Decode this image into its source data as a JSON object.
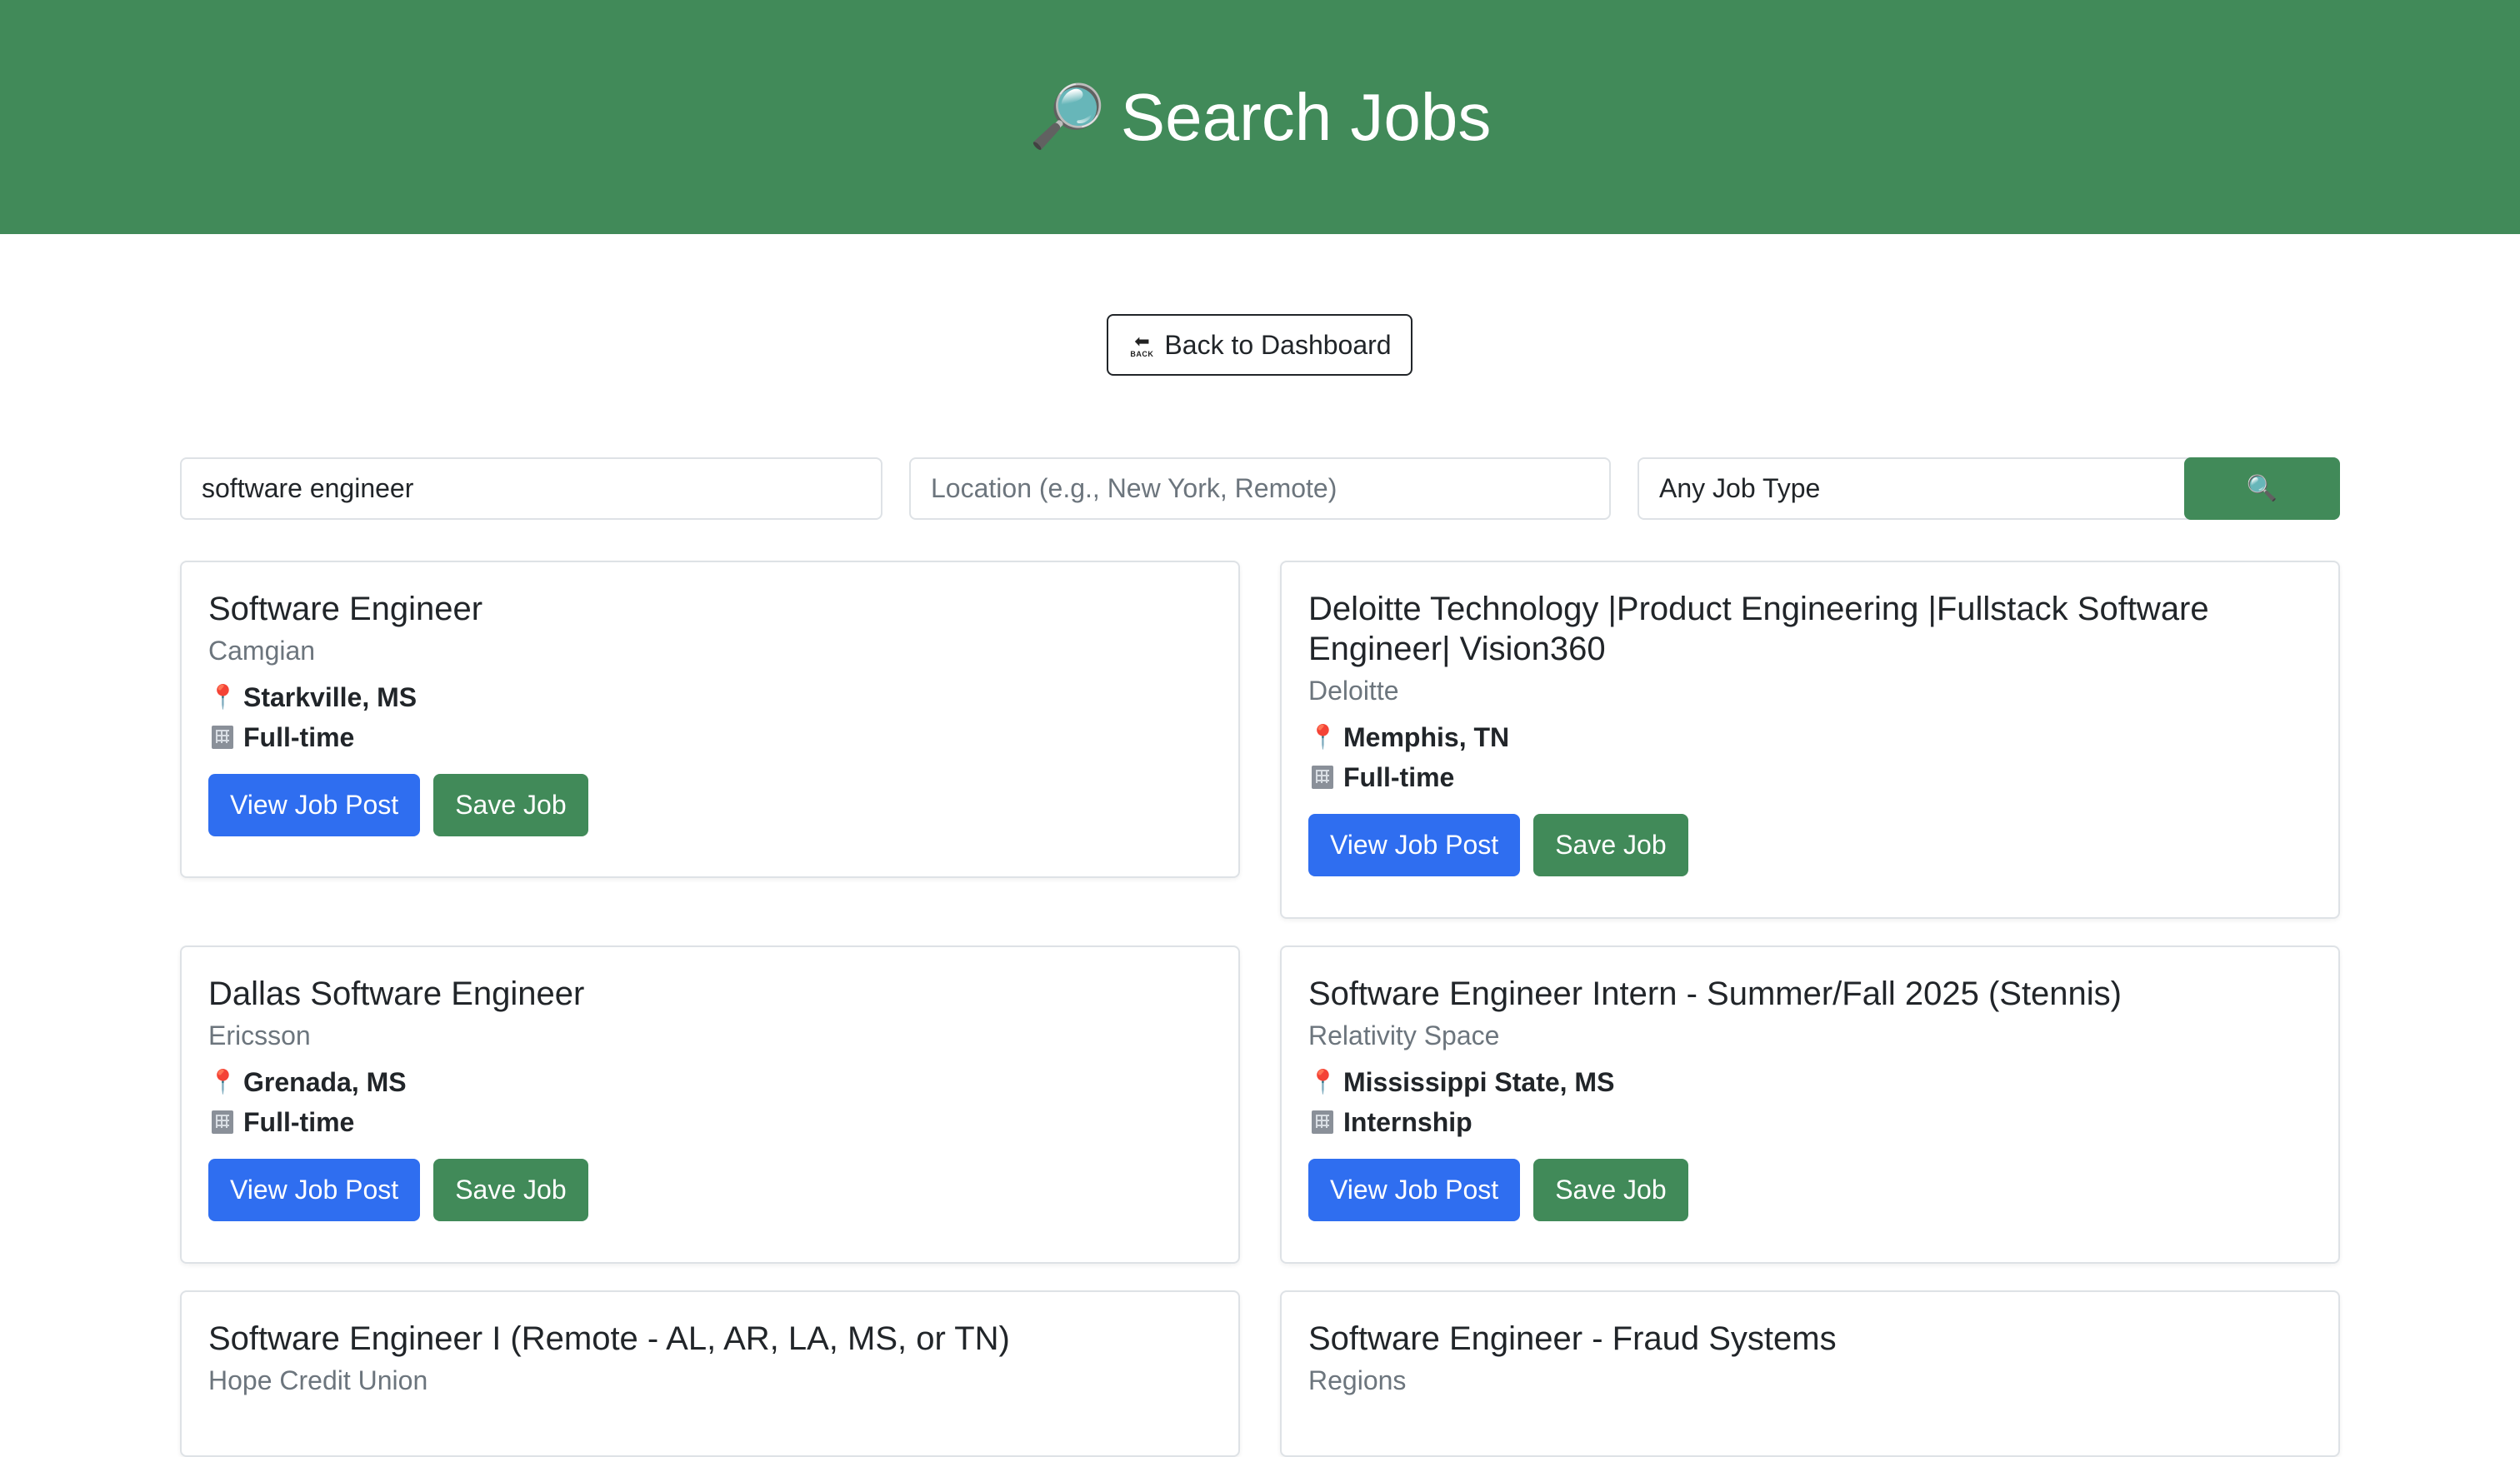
{
  "header": {
    "icon": "magnifying-glass-tilted-right-icon",
    "icon_glyph": "🔎",
    "title": "Search Jobs",
    "bg_color": "#418a59"
  },
  "back_button": {
    "icon": "back-arrow-icon",
    "label": "Back to Dashboard"
  },
  "search": {
    "keyword_value": "software engineer",
    "location_placeholder": "Location (e.g., New York, Remote)",
    "location_value": "",
    "job_type_selected": "Any Job Type",
    "search_icon": "search-icon",
    "search_glyph": "🔍"
  },
  "jobs": [
    {
      "title": "Software Engineer",
      "company": "Camgian",
      "location": "Starkville, MS",
      "type": "Full-time",
      "view_label": "View Job Post",
      "save_label": "Save Job"
    },
    {
      "title": "Deloitte Technology |Product Engineering |Fullstack Software Engineer| Vision360",
      "company": "Deloitte",
      "location": "Memphis, TN",
      "type": "Full-time",
      "view_label": "View Job Post",
      "save_label": "Save Job"
    },
    {
      "title": "Dallas Software Engineer",
      "company": "Ericsson",
      "location": "Grenada, MS",
      "type": "Full-time",
      "view_label": "View Job Post",
      "save_label": "Save Job"
    },
    {
      "title": "Software Engineer Intern - Summer/Fall 2025 (Stennis)",
      "company": "Relativity Space",
      "location": "Mississippi State, MS",
      "type": "Internship",
      "view_label": "View Job Post",
      "save_label": "Save Job"
    },
    {
      "title": "Software Engineer I (Remote - AL, AR, LA, MS, or TN)",
      "company": "Hope Credit Union"
    },
    {
      "title": "Software Engineer - Fraud Systems",
      "company": "Regions"
    }
  ],
  "colors": {
    "primary_green": "#418a59",
    "view_blue": "#2f6ef0",
    "muted_text": "#6c757d"
  }
}
